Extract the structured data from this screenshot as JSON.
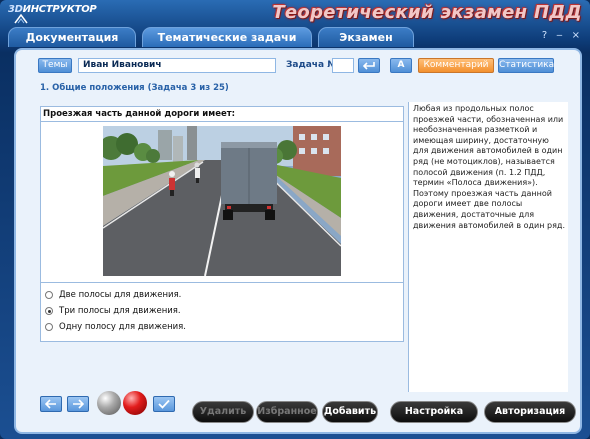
{
  "app": {
    "logo_3d": "3D",
    "logo_text": "ИНСТРУКТОР",
    "title": "Теоретический экзамен ПДД",
    "help": "?",
    "minimize": "‒",
    "close": "×"
  },
  "tabs": [
    {
      "label": "Документация",
      "active": false
    },
    {
      "label": "Тематические задачи",
      "active": true
    },
    {
      "label": "Экзамен",
      "active": false
    }
  ],
  "toolbar": {
    "themes_label": "Темы",
    "student_name": "Иван Иванович",
    "task_label": "Задача №",
    "task_value": "",
    "go_icon": "enter-arrow-icon",
    "a_label": "A",
    "comments_label": "Комментарий",
    "stats_label": "Статистика"
  },
  "section": {
    "title": "1. Общие положения (Задача 3 из 25)"
  },
  "question": {
    "text": "Проезжая часть данной дороги имеет:",
    "answers": [
      {
        "label": "Две полосы для движения.",
        "checked": false
      },
      {
        "label": "Три полосы для движения.",
        "checked": true
      },
      {
        "label": "Одну полосу для движения.",
        "checked": false
      }
    ]
  },
  "explanation": {
    "text": "Любая из продольных полос проезжей части, обозначенная или необозначенная разметкой и имеющая ширину, достаточную для движения автомобилей в один ряд (не мотоциклов), называется полосой движения (п. 1.2 ПДД, термин «Полоса движения»). Поэтому проезжая часть данной дороги имеет две полосы движения, достаточные для движения автомобилей в один ряд."
  },
  "bottom": {
    "back_icon": "arrow-left-icon",
    "forward_icon": "arrow-right-icon",
    "check_icon": "checkmark-icon",
    "delete_label": "Удалить",
    "favorites_label": "Избранное",
    "add_label": "Добавить",
    "settings_label": "Настройка",
    "auth_label": "Авторизация"
  }
}
